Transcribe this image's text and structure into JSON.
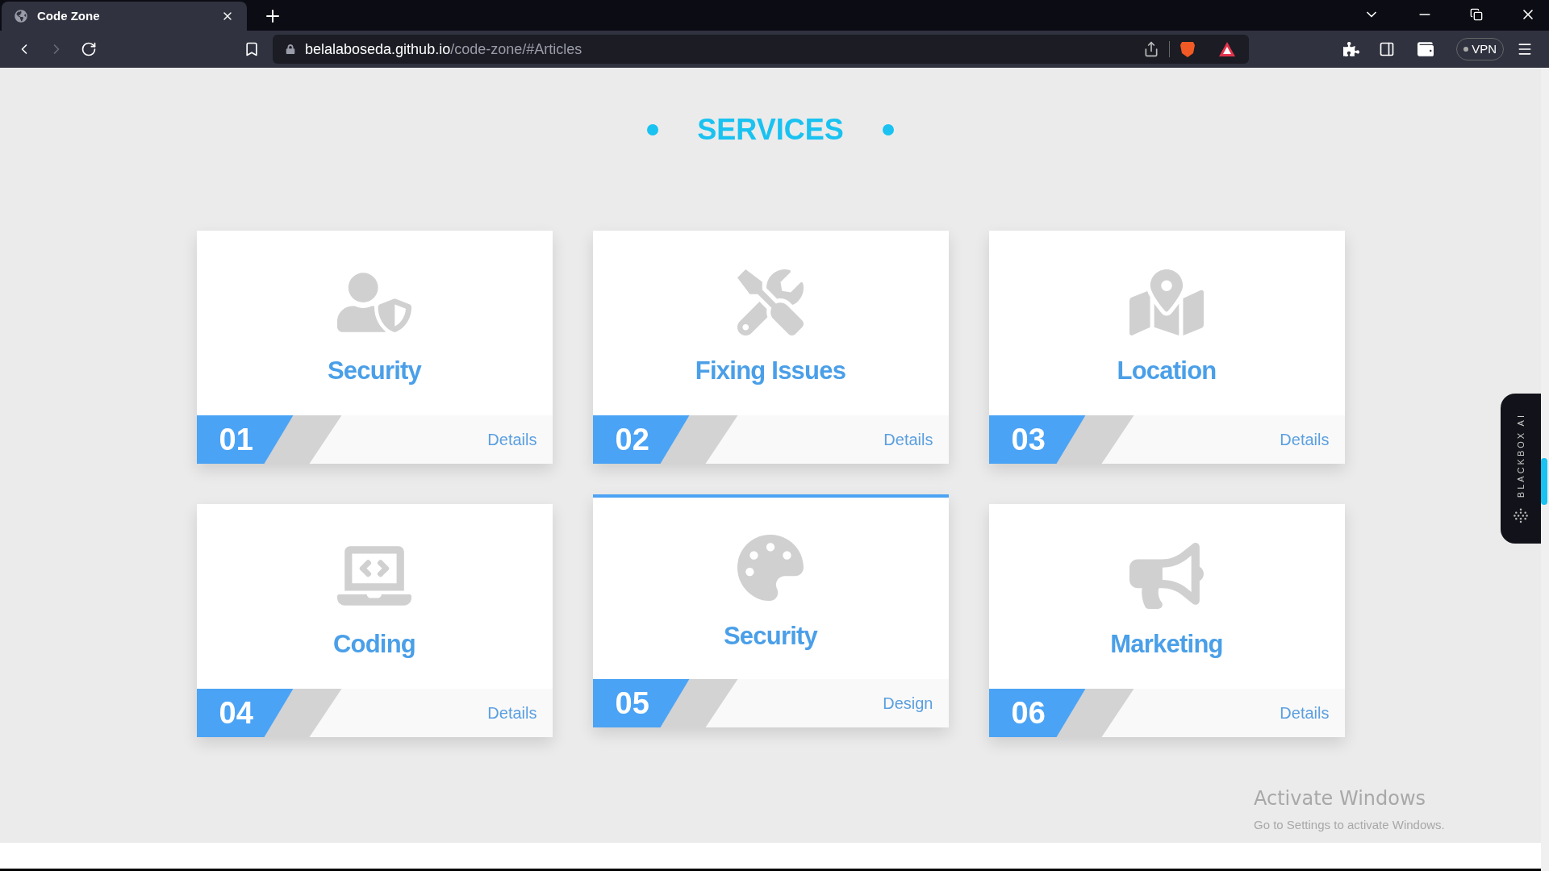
{
  "browser": {
    "tab": {
      "title": "Code Zone"
    },
    "url": {
      "host": "belalaboseda.github.io",
      "path": "/code-zone/#Articles"
    },
    "vpn": "VPN"
  },
  "section": {
    "title": "SERVICES"
  },
  "cards": [
    {
      "title": "Security",
      "number": "01",
      "link": "Details",
      "highlighted": false
    },
    {
      "title": "Fixing Issues",
      "number": "02",
      "link": "Details",
      "highlighted": false
    },
    {
      "title": "Location",
      "number": "03",
      "link": "Details",
      "highlighted": false
    },
    {
      "title": "Coding",
      "number": "04",
      "link": "Details",
      "highlighted": false
    },
    {
      "title": "Security",
      "number": "05",
      "link": "Design",
      "highlighted": true
    },
    {
      "title": "Marketing",
      "number": "06",
      "link": "Details",
      "highlighted": false
    }
  ],
  "side_widget": {
    "label": "BLACKBOX AI"
  },
  "os_notice": {
    "title": "Activate Windows",
    "text": "Go to Settings to activate Windows."
  }
}
